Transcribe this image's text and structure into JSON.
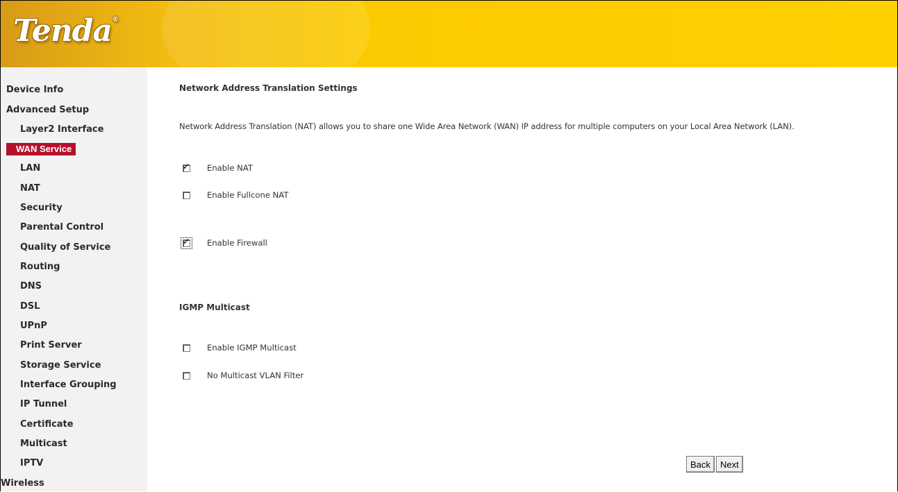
{
  "brand": {
    "logo_text": "Tenda",
    "trademark": "®"
  },
  "sidebar": {
    "items": [
      {
        "label": "Device Info",
        "level": "top"
      },
      {
        "label": "Advanced Setup",
        "level": "top"
      },
      {
        "label": "Layer2 Interface",
        "level": "sub"
      },
      {
        "label": "WAN Service",
        "level": "sub",
        "active": true
      },
      {
        "label": "LAN",
        "level": "sub"
      },
      {
        "label": "NAT",
        "level": "sub"
      },
      {
        "label": "Security",
        "level": "sub"
      },
      {
        "label": "Parental Control",
        "level": "sub"
      },
      {
        "label": "Quality of Service",
        "level": "sub"
      },
      {
        "label": "Routing",
        "level": "sub"
      },
      {
        "label": "DNS",
        "level": "sub"
      },
      {
        "label": "DSL",
        "level": "sub"
      },
      {
        "label": "UPnP",
        "level": "sub"
      },
      {
        "label": "Print Server",
        "level": "sub"
      },
      {
        "label": "Storage Service",
        "level": "sub"
      },
      {
        "label": "Interface Grouping",
        "level": "sub"
      },
      {
        "label": "IP Tunnel",
        "level": "sub"
      },
      {
        "label": "Certificate",
        "level": "sub"
      },
      {
        "label": "Multicast",
        "level": "sub"
      },
      {
        "label": "IPTV",
        "level": "sub"
      },
      {
        "label": "Wireless",
        "level": "top"
      }
    ]
  },
  "main": {
    "nat_heading": "Network Address Translation Settings",
    "nat_description": "Network Address Translation (NAT) allows you to share one Wide Area Network (WAN) IP address for multiple computers on your Local Area Network (LAN).",
    "options": {
      "enable_nat": {
        "label": "Enable NAT",
        "checked": true
      },
      "enable_fullcone_nat": {
        "label": "Enable Fullcone NAT",
        "checked": false
      },
      "enable_firewall": {
        "label": "Enable Firewall",
        "checked": true
      }
    },
    "igmp_heading": "IGMP Multicast",
    "igmp_options": {
      "enable_igmp_multicast": {
        "label": "Enable IGMP Multicast",
        "checked": false
      },
      "no_multicast_vlan_filter": {
        "label": "No Multicast VLAN Filter",
        "checked": false
      }
    },
    "buttons": {
      "back": "Back",
      "next": "Next"
    }
  }
}
